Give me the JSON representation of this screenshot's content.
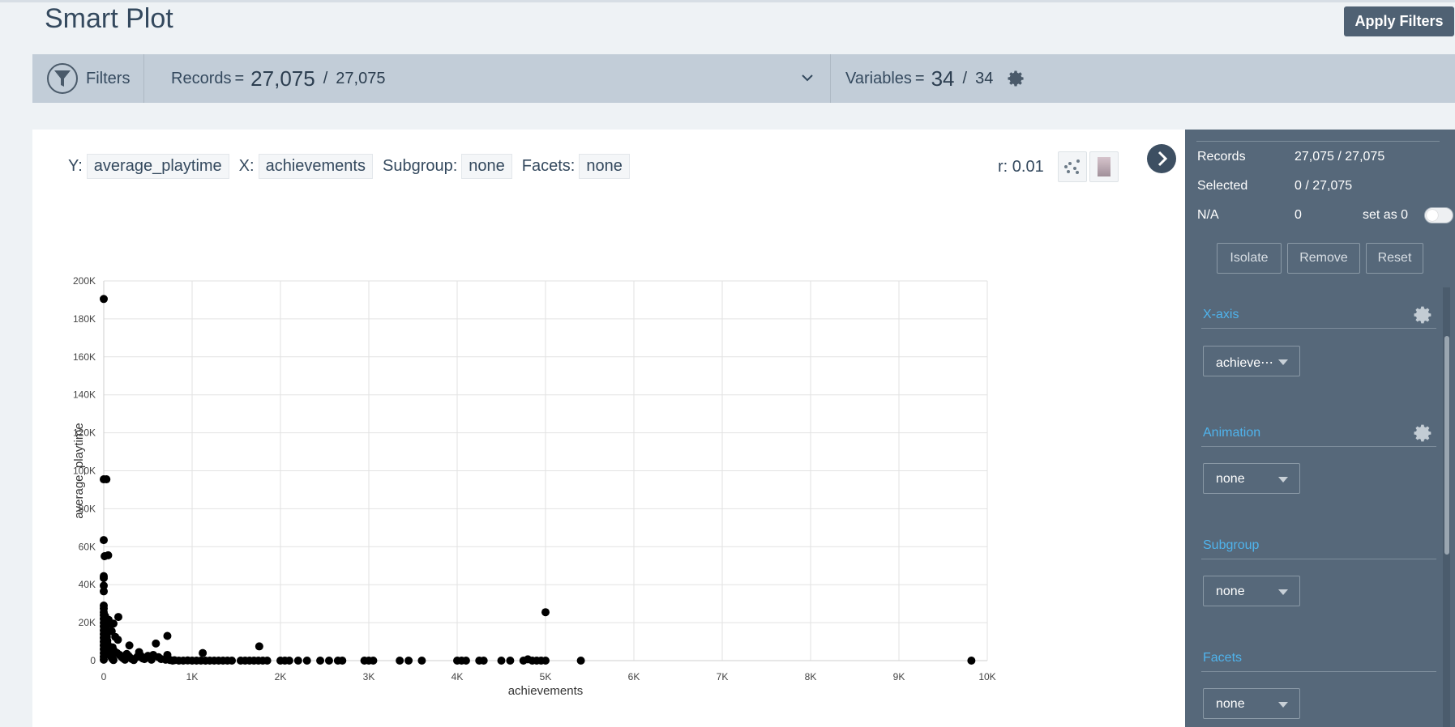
{
  "page": {
    "title": "Smart Plot",
    "apply_label": "Apply Filters"
  },
  "filterbar": {
    "filters_label": "Filters",
    "records_label": "Records",
    "equals": "=",
    "records_filtered": "27,075",
    "records_total": "27,075",
    "variables_label": "Variables",
    "variables_selected": "34",
    "variables_total": "34",
    "slash": "/"
  },
  "toolbar": {
    "y_label": "Y:",
    "y_value": "average_playtime",
    "x_label": "X:",
    "x_value": "achievements",
    "subgroup_label": "Subgroup:",
    "subgroup_value": "none",
    "facets_label": "Facets:",
    "facets_value": "none",
    "r_value": "r: 0.01"
  },
  "chart_data": {
    "type": "scatter",
    "xlabel": "achievements",
    "ylabel": "average_playtime",
    "xlim": [
      0,
      10000
    ],
    "ylim": [
      0,
      200000
    ],
    "xticks": [
      0,
      1000,
      2000,
      3000,
      4000,
      5000,
      6000,
      7000,
      8000,
      9000,
      10000
    ],
    "xtick_labels": [
      "0",
      "1K",
      "2K",
      "3K",
      "4K",
      "5K",
      "6K",
      "7K",
      "8K",
      "9K",
      "10K"
    ],
    "yticks": [
      0,
      20000,
      40000,
      60000,
      80000,
      100000,
      120000,
      140000,
      160000,
      180000,
      200000
    ],
    "ytick_labels": [
      "0",
      "20K",
      "40K",
      "60K",
      "80K",
      "100K",
      "120K",
      "140K",
      "160K",
      "180K",
      "200K"
    ],
    "grid": true,
    "color": "#000000",
    "points": [
      [
        0,
        190500
      ],
      [
        0,
        95500
      ],
      [
        30,
        95500
      ],
      [
        0,
        63500
      ],
      [
        50,
        55500
      ],
      [
        10,
        55000
      ],
      [
        0,
        44500
      ],
      [
        0,
        43500
      ],
      [
        0,
        39500
      ],
      [
        0,
        36500
      ],
      [
        0,
        29000
      ],
      [
        0,
        27500
      ],
      [
        0,
        25500
      ],
      [
        0,
        24000
      ],
      [
        0,
        22000
      ],
      [
        0,
        20000
      ],
      [
        0,
        18000
      ],
      [
        0,
        16000
      ],
      [
        0,
        14000
      ],
      [
        0,
        12000
      ],
      [
        0,
        10000
      ],
      [
        0,
        8000
      ],
      [
        0,
        6000
      ],
      [
        0,
        4000
      ],
      [
        0,
        2000
      ],
      [
        0,
        500
      ],
      [
        15,
        23500
      ],
      [
        20,
        21000
      ],
      [
        25,
        17500
      ],
      [
        30,
        15000
      ],
      [
        35,
        12500
      ],
      [
        40,
        10500
      ],
      [
        45,
        8500
      ],
      [
        50,
        6500
      ],
      [
        60,
        5000
      ],
      [
        70,
        3500
      ],
      [
        80,
        2500
      ],
      [
        90,
        1500
      ],
      [
        100,
        800
      ],
      [
        110,
        300
      ],
      [
        55,
        21500
      ],
      [
        75,
        19500
      ],
      [
        110,
        19500
      ],
      [
        165,
        23000
      ],
      [
        90,
        15500
      ],
      [
        130,
        12500
      ],
      [
        160,
        11000
      ],
      [
        100,
        7000
      ],
      [
        120,
        5000
      ],
      [
        150,
        4000
      ],
      [
        180,
        3000
      ],
      [
        200,
        2000
      ],
      [
        220,
        1200
      ],
      [
        240,
        500
      ],
      [
        260,
        3500
      ],
      [
        280,
        2500
      ],
      [
        300,
        1500
      ],
      [
        320,
        800
      ],
      [
        340,
        300
      ],
      [
        380,
        2000
      ],
      [
        400,
        4500
      ],
      [
        420,
        2500
      ],
      [
        440,
        1200
      ],
      [
        290,
        8000
      ],
      [
        460,
        800
      ],
      [
        500,
        2500
      ],
      [
        520,
        1500
      ],
      [
        540,
        500
      ],
      [
        590,
        9000
      ],
      [
        560,
        3000
      ],
      [
        620,
        1800
      ],
      [
        650,
        800
      ],
      [
        700,
        500
      ],
      [
        720,
        13000
      ],
      [
        720,
        3000
      ],
      [
        750,
        300
      ],
      [
        780,
        0
      ],
      [
        800,
        200
      ],
      [
        850,
        0
      ],
      [
        900,
        0
      ],
      [
        950,
        100
      ],
      [
        1000,
        0
      ],
      [
        1050,
        0
      ],
      [
        1100,
        0
      ],
      [
        1120,
        4000
      ],
      [
        1150,
        0
      ],
      [
        1200,
        0
      ],
      [
        1250,
        0
      ],
      [
        1300,
        0
      ],
      [
        1350,
        0
      ],
      [
        1400,
        0
      ],
      [
        1450,
        0
      ],
      [
        1550,
        0
      ],
      [
        1600,
        0
      ],
      [
        1650,
        0
      ],
      [
        1700,
        0
      ],
      [
        1750,
        0
      ],
      [
        1760,
        7500
      ],
      [
        1800,
        0
      ],
      [
        1850,
        0
      ],
      [
        2000,
        0
      ],
      [
        2050,
        0
      ],
      [
        2100,
        0
      ],
      [
        2200,
        0
      ],
      [
        2300,
        0
      ],
      [
        2450,
        0
      ],
      [
        2550,
        0
      ],
      [
        2650,
        0
      ],
      [
        2700,
        0
      ],
      [
        2950,
        0
      ],
      [
        3000,
        0
      ],
      [
        3050,
        0
      ],
      [
        3350,
        0
      ],
      [
        3450,
        0
      ],
      [
        3600,
        0
      ],
      [
        4000,
        0
      ],
      [
        4050,
        0
      ],
      [
        4100,
        0
      ],
      [
        4250,
        0
      ],
      [
        4300,
        0
      ],
      [
        4500,
        0
      ],
      [
        4600,
        0
      ],
      [
        4750,
        0
      ],
      [
        4800,
        700
      ],
      [
        4850,
        0
      ],
      [
        4900,
        0
      ],
      [
        4950,
        0
      ],
      [
        5000,
        0
      ],
      [
        5000,
        25500
      ],
      [
        5400,
        0
      ],
      [
        9820,
        0
      ]
    ]
  },
  "sidebar": {
    "records_label": "Records",
    "records_value": "27,075 / 27,075",
    "selected_label": "Selected",
    "selected_value": "0 / 27,075",
    "na_label": "N/A",
    "na_value": "0",
    "set_as_zero": "set as 0",
    "isolate_label": "Isolate",
    "remove_label": "Remove",
    "reset_label": "Reset",
    "xaxis_title": "X-axis",
    "xaxis_value": "achieve⋯",
    "animation_title": "Animation",
    "animation_value": "none",
    "subgroup_title": "Subgroup",
    "subgroup_value": "none",
    "facets_title": "Facets",
    "facets_value": "none"
  },
  "icons": {
    "filter": "funnel-icon",
    "chevron": "chevron-down-icon",
    "gear": "gear-icon",
    "scatter": "scatter-plot-icon",
    "gradient": "color-gradient-icon",
    "expand": "chevron-right-icon"
  }
}
